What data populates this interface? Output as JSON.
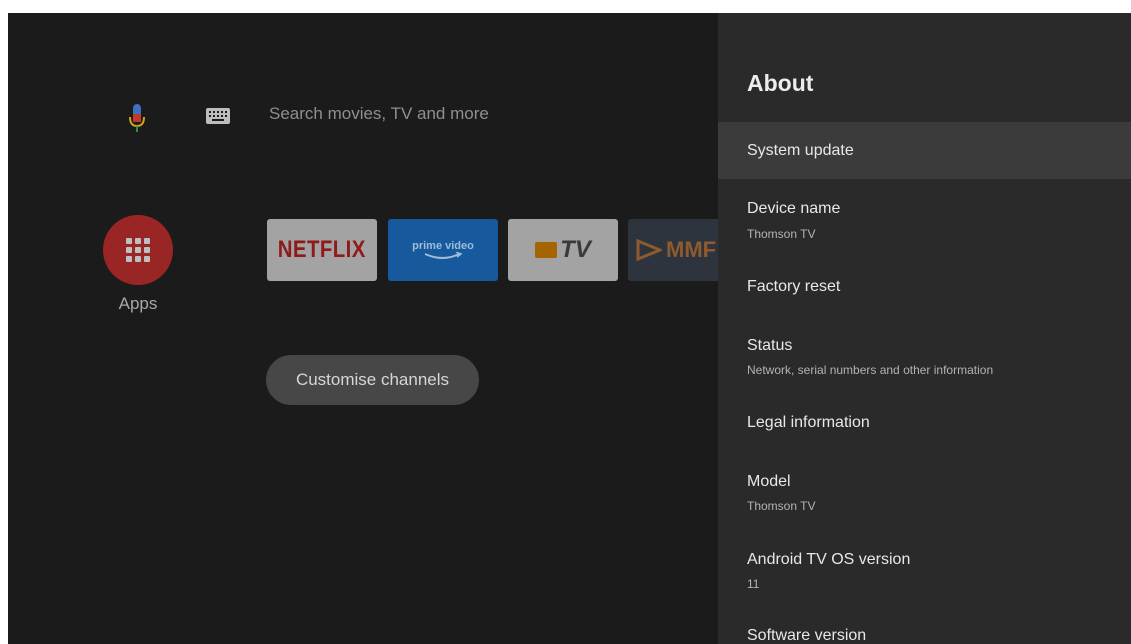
{
  "home": {
    "search_placeholder": "Search movies, TV and more",
    "apps_label": "Apps",
    "channel_tiles": [
      {
        "name": "NETFLIX"
      },
      {
        "name": "prime video"
      },
      {
        "name": "TV"
      },
      {
        "name": "MMF"
      }
    ],
    "customise_button": "Customise channels"
  },
  "settings_panel": {
    "title": "About",
    "items": [
      {
        "label": "System update",
        "selected": true
      },
      {
        "label": "Device name",
        "sub": "Thomson TV"
      },
      {
        "label": "Factory reset"
      },
      {
        "label": "Status",
        "sub": "Network, serial numbers and other information"
      },
      {
        "label": "Legal information"
      },
      {
        "label": "Model",
        "sub": "Thomson TV"
      },
      {
        "label": "Android TV OS version",
        "sub": "11"
      },
      {
        "label": "Software version"
      }
    ]
  },
  "colors": {
    "background": "#1b1b1b",
    "panel": "#2a2a2b",
    "selected_row": "#3b3b3c",
    "apps_button": "#9a2525"
  }
}
